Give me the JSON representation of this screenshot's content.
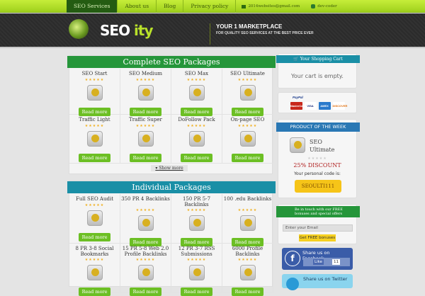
{
  "nav": {
    "items": [
      "SEO Services",
      "About us",
      "Blog",
      "Privacy policy"
    ],
    "email": "2014websites@gmail.com",
    "skype": "dev-coder"
  },
  "header": {
    "logo_main": "SEO",
    "logo_accent": "ity",
    "tagline": "YOUR  1 MARKETPLACE",
    "subtagline": "FOR QUALITY SEO SERVICES AT THE BEST PRICE EVER"
  },
  "complete": {
    "title": "Complete SEO Packages",
    "show_more": "Show more",
    "items": [
      {
        "name": "SEO Start"
      },
      {
        "name": "SEO Medium"
      },
      {
        "name": "SEO Max"
      },
      {
        "name": "SEO Ultimate"
      },
      {
        "name": "Traffic Light"
      },
      {
        "name": "Traffic Super"
      },
      {
        "name": "DoFollow Pack"
      },
      {
        "name": "On-page SEO"
      }
    ]
  },
  "individual": {
    "title": "Individual Packages",
    "items": [
      {
        "name": "Full SEO Audit"
      },
      {
        "name": "350 PR 4 Backlinks"
      },
      {
        "name": "150 PR 5-7 Backlinks"
      },
      {
        "name": "100 .edu Backlinks"
      },
      {
        "name": "8 PR 3-8 Social Bookmarks"
      },
      {
        "name": "15 PR 5-8 Web 2.0 Profile Backlinks"
      },
      {
        "name": "12 PR 3-7 RSS Submissions"
      },
      {
        "name": "6000 Profile Backlinks"
      }
    ]
  },
  "read_more": "Read more",
  "stars": "★★★★★",
  "cart": {
    "title": "Your Shopping Cart",
    "empty": "Your cart is empty."
  },
  "payments": {
    "paypal": "PayPal",
    "cards": [
      "MasterCard",
      "VISA",
      "AMEX",
      "DISCOVER"
    ]
  },
  "potw": {
    "title": "PRODUCT OF THE WEEK",
    "name": "SEO Ultimate",
    "discount": "25% DISCOUNT",
    "code_label": "Your personal code is:",
    "code": "SEOULTI111"
  },
  "newsletter": {
    "text": "Be in touch with our FREE bonuses and special offers",
    "placeholder": "Enter your Email",
    "button": "Get FREE bonuses"
  },
  "facebook": {
    "label": "Share us on Facebook",
    "like": "Like",
    "count": "11"
  },
  "twitter": {
    "label": "Share us on Twitter"
  },
  "colors": {
    "green": "#25963a",
    "teal": "#1a8fa6",
    "lime": "#9fd01c",
    "button": "#6cbf24"
  }
}
